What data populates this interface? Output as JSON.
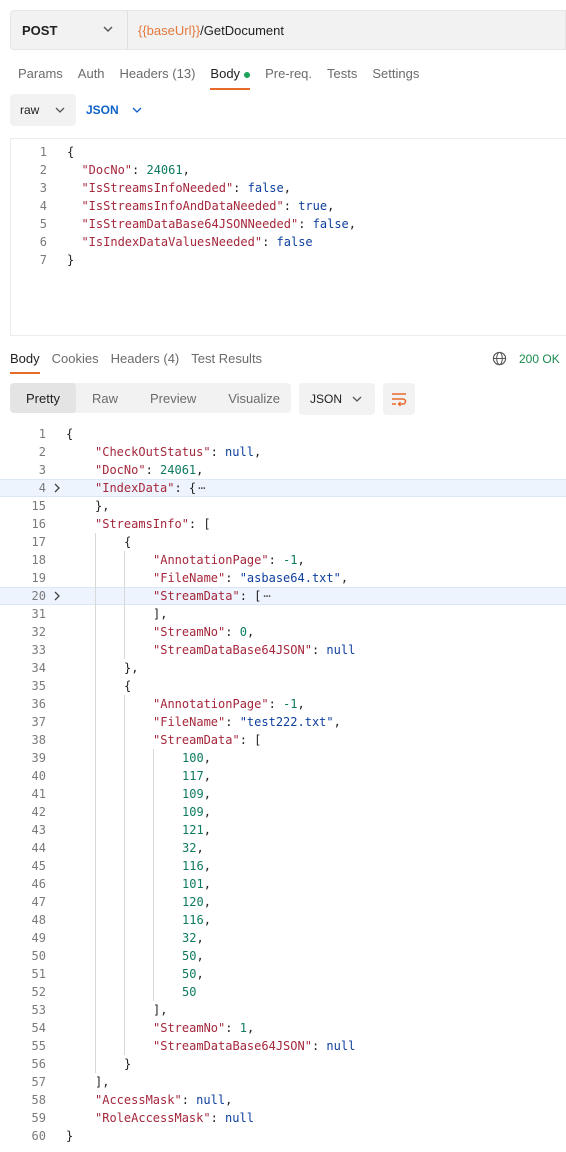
{
  "request": {
    "method": "POST",
    "url_var": "{{baseUrl}}",
    "url_path": "/GetDocument"
  },
  "request_tabs": [
    "Params",
    "Auth",
    "Headers (13)",
    "Body",
    "Pre-req.",
    "Tests",
    "Settings"
  ],
  "active_request_tab": "Body",
  "body_type": "raw",
  "body_format": "JSON",
  "request_lines": [
    {
      "n": "1",
      "t": [
        [
          "p",
          "{"
        ]
      ]
    },
    {
      "n": "2",
      "t": [
        [
          "p",
          "  "
        ],
        [
          "k",
          "\"DocNo\""
        ],
        [
          "p",
          ": "
        ],
        [
          "n",
          "24061"
        ],
        [
          "p",
          ","
        ]
      ]
    },
    {
      "n": "3",
      "t": [
        [
          "p",
          "  "
        ],
        [
          "k",
          "\"IsStreamsInfoNeeded\""
        ],
        [
          "p",
          ": "
        ],
        [
          "b",
          "false"
        ],
        [
          "p",
          ","
        ]
      ]
    },
    {
      "n": "4",
      "t": [
        [
          "p",
          "  "
        ],
        [
          "k",
          "\"IsStreamsInfoAndDataNeeded\""
        ],
        [
          "p",
          ": "
        ],
        [
          "b",
          "true"
        ],
        [
          "p",
          ","
        ]
      ]
    },
    {
      "n": "5",
      "t": [
        [
          "p",
          "  "
        ],
        [
          "k",
          "\"IsStreamDataBase64JSONNeeded\""
        ],
        [
          "p",
          ": "
        ],
        [
          "b",
          "false"
        ],
        [
          "p",
          ","
        ]
      ]
    },
    {
      "n": "6",
      "t": [
        [
          "p",
          "  "
        ],
        [
          "k",
          "\"IsIndexDataValuesNeeded\""
        ],
        [
          "p",
          ": "
        ],
        [
          "b",
          "false"
        ]
      ]
    },
    {
      "n": "7",
      "t": [
        [
          "p",
          "}"
        ]
      ]
    }
  ],
  "response_tabs": [
    "Body",
    "Cookies",
    "Headers (4)",
    "Test Results"
  ],
  "active_response_tab": "Body",
  "status": "200 OK",
  "view_tabs": [
    "Pretty",
    "Raw",
    "Preview",
    "Visualize"
  ],
  "active_view_tab": "Pretty",
  "response_format": "JSON",
  "response_lines": [
    {
      "n": "1",
      "i": 0,
      "t": [
        [
          "p",
          "{"
        ]
      ]
    },
    {
      "n": "2",
      "i": 1,
      "t": [
        [
          "k",
          "\"CheckOutStatus\""
        ],
        [
          "p",
          ": "
        ],
        [
          "b",
          "null"
        ],
        [
          "p",
          ","
        ]
      ]
    },
    {
      "n": "3",
      "i": 1,
      "t": [
        [
          "k",
          "\"DocNo\""
        ],
        [
          "p",
          ": "
        ],
        [
          "n",
          "24061"
        ],
        [
          "p",
          ","
        ]
      ]
    },
    {
      "n": "4",
      "i": 1,
      "fold": true,
      "hl": true,
      "t": [
        [
          "k",
          "\"IndexData\""
        ],
        [
          "p",
          ": {"
        ],
        [
          "e",
          "⋯"
        ]
      ]
    },
    {
      "n": "15",
      "i": 1,
      "t": [
        [
          "p",
          "},"
        ]
      ]
    },
    {
      "n": "16",
      "i": 1,
      "t": [
        [
          "k",
          "\"StreamsInfo\""
        ],
        [
          "p",
          ": ["
        ]
      ]
    },
    {
      "n": "17",
      "i": 2,
      "t": [
        [
          "p",
          "{"
        ]
      ]
    },
    {
      "n": "18",
      "i": 3,
      "t": [
        [
          "k",
          "\"AnnotationPage\""
        ],
        [
          "p",
          ": "
        ],
        [
          "n",
          "-1"
        ],
        [
          "p",
          ","
        ]
      ]
    },
    {
      "n": "19",
      "i": 3,
      "t": [
        [
          "k",
          "\"FileName\""
        ],
        [
          "p",
          ": "
        ],
        [
          "s",
          "\"asbase64.txt\""
        ],
        [
          "p",
          ","
        ]
      ]
    },
    {
      "n": "20",
      "i": 3,
      "fold": true,
      "hl": true,
      "t": [
        [
          "k",
          "\"StreamData\""
        ],
        [
          "p",
          ": ["
        ],
        [
          "e",
          "⋯"
        ]
      ]
    },
    {
      "n": "31",
      "i": 3,
      "t": [
        [
          "p",
          "],"
        ]
      ]
    },
    {
      "n": "32",
      "i": 3,
      "t": [
        [
          "k",
          "\"StreamNo\""
        ],
        [
          "p",
          ": "
        ],
        [
          "n",
          "0"
        ],
        [
          "p",
          ","
        ]
      ]
    },
    {
      "n": "33",
      "i": 3,
      "t": [
        [
          "k",
          "\"StreamDataBase64JSON\""
        ],
        [
          "p",
          ": "
        ],
        [
          "b",
          "null"
        ]
      ]
    },
    {
      "n": "34",
      "i": 2,
      "t": [
        [
          "p",
          "},"
        ]
      ]
    },
    {
      "n": "35",
      "i": 2,
      "t": [
        [
          "p",
          "{"
        ]
      ]
    },
    {
      "n": "36",
      "i": 3,
      "t": [
        [
          "k",
          "\"AnnotationPage\""
        ],
        [
          "p",
          ": "
        ],
        [
          "n",
          "-1"
        ],
        [
          "p",
          ","
        ]
      ]
    },
    {
      "n": "37",
      "i": 3,
      "t": [
        [
          "k",
          "\"FileName\""
        ],
        [
          "p",
          ": "
        ],
        [
          "s",
          "\"test222.txt\""
        ],
        [
          "p",
          ","
        ]
      ]
    },
    {
      "n": "38",
      "i": 3,
      "t": [
        [
          "k",
          "\"StreamData\""
        ],
        [
          "p",
          ": ["
        ]
      ]
    },
    {
      "n": "39",
      "i": 4,
      "t": [
        [
          "n",
          "100"
        ],
        [
          "p",
          ","
        ]
      ]
    },
    {
      "n": "40",
      "i": 4,
      "t": [
        [
          "n",
          "117"
        ],
        [
          "p",
          ","
        ]
      ]
    },
    {
      "n": "41",
      "i": 4,
      "t": [
        [
          "n",
          "109"
        ],
        [
          "p",
          ","
        ]
      ]
    },
    {
      "n": "42",
      "i": 4,
      "t": [
        [
          "n",
          "109"
        ],
        [
          "p",
          ","
        ]
      ]
    },
    {
      "n": "43",
      "i": 4,
      "t": [
        [
          "n",
          "121"
        ],
        [
          "p",
          ","
        ]
      ]
    },
    {
      "n": "44",
      "i": 4,
      "t": [
        [
          "n",
          "32"
        ],
        [
          "p",
          ","
        ]
      ]
    },
    {
      "n": "45",
      "i": 4,
      "t": [
        [
          "n",
          "116"
        ],
        [
          "p",
          ","
        ]
      ]
    },
    {
      "n": "46",
      "i": 4,
      "t": [
        [
          "n",
          "101"
        ],
        [
          "p",
          ","
        ]
      ]
    },
    {
      "n": "47",
      "i": 4,
      "t": [
        [
          "n",
          "120"
        ],
        [
          "p",
          ","
        ]
      ]
    },
    {
      "n": "48",
      "i": 4,
      "t": [
        [
          "n",
          "116"
        ],
        [
          "p",
          ","
        ]
      ]
    },
    {
      "n": "49",
      "i": 4,
      "t": [
        [
          "n",
          "32"
        ],
        [
          "p",
          ","
        ]
      ]
    },
    {
      "n": "50",
      "i": 4,
      "t": [
        [
          "n",
          "50"
        ],
        [
          "p",
          ","
        ]
      ]
    },
    {
      "n": "51",
      "i": 4,
      "t": [
        [
          "n",
          "50"
        ],
        [
          "p",
          ","
        ]
      ]
    },
    {
      "n": "52",
      "i": 4,
      "t": [
        [
          "n",
          "50"
        ]
      ]
    },
    {
      "n": "53",
      "i": 3,
      "t": [
        [
          "p",
          "],"
        ]
      ]
    },
    {
      "n": "54",
      "i": 3,
      "t": [
        [
          "k",
          "\"StreamNo\""
        ],
        [
          "p",
          ": "
        ],
        [
          "n",
          "1"
        ],
        [
          "p",
          ","
        ]
      ]
    },
    {
      "n": "55",
      "i": 3,
      "t": [
        [
          "k",
          "\"StreamDataBase64JSON\""
        ],
        [
          "p",
          ": "
        ],
        [
          "b",
          "null"
        ]
      ]
    },
    {
      "n": "56",
      "i": 2,
      "t": [
        [
          "p",
          "}"
        ]
      ]
    },
    {
      "n": "57",
      "i": 1,
      "t": [
        [
          "p",
          "],"
        ]
      ]
    },
    {
      "n": "58",
      "i": 1,
      "t": [
        [
          "k",
          "\"AccessMask\""
        ],
        [
          "p",
          ": "
        ],
        [
          "b",
          "null"
        ],
        [
          "p",
          ","
        ]
      ]
    },
    {
      "n": "59",
      "i": 1,
      "t": [
        [
          "k",
          "\"RoleAccessMask\""
        ],
        [
          "p",
          ": "
        ],
        [
          "b",
          "null"
        ]
      ]
    },
    {
      "n": "60",
      "i": 0,
      "t": [
        [
          "p",
          "}"
        ]
      ]
    }
  ],
  "colors": {
    "accent": "#e8692c",
    "key": "#a5273c",
    "number": "#0d7a5f",
    "keyword": "#0e3f9e",
    "status_ok": "#1a8a4c",
    "url_var": "#e5793c"
  },
  "icons": [
    "chevron-down-icon",
    "globe-icon",
    "wrap-lines-icon",
    "fold-arrow-icon"
  ]
}
